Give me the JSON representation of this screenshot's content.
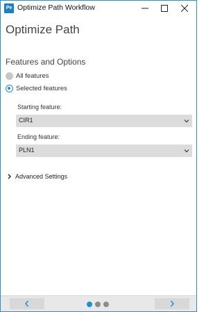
{
  "window": {
    "app_icon_text": "Pe",
    "title": "Optimize Path Workflow"
  },
  "page": {
    "title": "Optimize Path"
  },
  "features": {
    "section_title": "Features and Options",
    "options": [
      {
        "label": "All features",
        "checked": false
      },
      {
        "label": "Selected features",
        "checked": true
      }
    ],
    "starting_label": "Starting feature:",
    "starting_value": "CIR1",
    "ending_label": "Ending feature:",
    "ending_value": "PLN1"
  },
  "advanced": {
    "label": "Advanced Settings",
    "expanded": false
  },
  "footer": {
    "page_count": 3,
    "current_page": 1
  },
  "colors": {
    "accent": "#1e90d6",
    "window_border": "#2b8fd6",
    "select_bg": "#dcdcdc",
    "footer_bg": "#e8e8e8"
  },
  "icons": {
    "minimize": "minimize-icon",
    "maximize": "maximize-icon",
    "close": "close-icon",
    "dropdown": "chevron-down-icon",
    "expand": "chevron-right-icon",
    "prev": "chevron-left-icon",
    "next": "chevron-right-icon"
  }
}
